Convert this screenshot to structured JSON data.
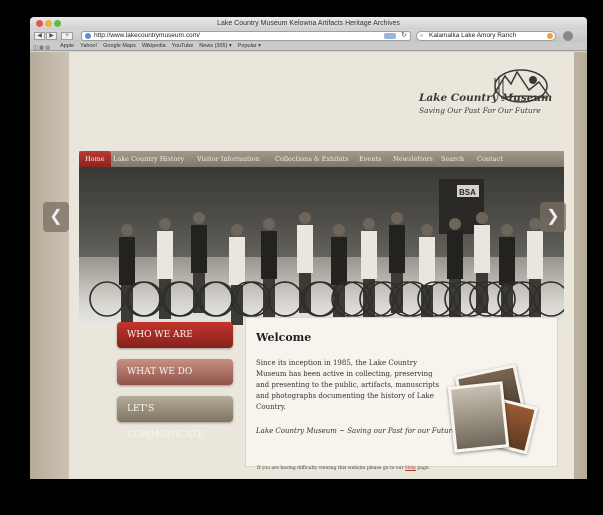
{
  "browser": {
    "title": "Lake Country Museum Kelowna Artifacts Heritage Archives",
    "url": "http://www.lakecountrymuseum.com/",
    "search_value": "Kalamalka Lake Amory Ranch",
    "back_icon": "back-arrow-icon",
    "bookmarks": [
      "Apple",
      "Yahoo!",
      "Google Maps",
      "Wikipedia",
      "YouTube",
      "News (365) ▾",
      "Popular ▾"
    ]
  },
  "site": {
    "logo_title": "Lake Country Museum",
    "logo_tagline": "Saving Our Past For Our Future",
    "menu": [
      "Home",
      "Lake Country History",
      "Visitor Information",
      "Collections & Exhibits",
      "Events",
      "Newsletters",
      "Search",
      "Contact"
    ],
    "hero_sign": "BSA",
    "buttons": [
      "WHO WE ARE",
      "WHAT WE DO",
      "LET'S COMMUNICATE"
    ],
    "welcome": {
      "title": "Welcome",
      "body": "Since its inception in 1985, the Lake Country Museum has been active in collecting, preserving and presenting to the public, artifacts, manuscripts and photographs documenting the history of Lake Country.",
      "motto": "Lake Country Museum ~ Saving our Past for our Future",
      "footer_before": "If you are having difficulty viewing this website please go to our ",
      "footer_link": "Help",
      "footer_after": " page."
    }
  },
  "colors": {
    "accent_red": "#b83a33",
    "menu_tan": "#8f8878",
    "page_bg": "#ebe6dc"
  }
}
